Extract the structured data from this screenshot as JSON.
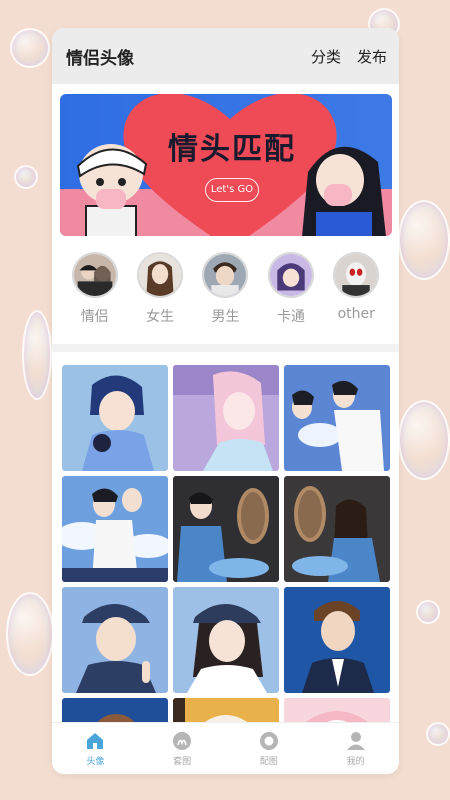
{
  "header": {
    "title": "情侣头像",
    "actions": [
      "分类",
      "发布"
    ]
  },
  "banner": {
    "title": "情头匹配",
    "subtitle": "Let's GO"
  },
  "categories": [
    {
      "label": "情侣",
      "icon": "couple-avatar"
    },
    {
      "label": "女生",
      "icon": "girl-avatar"
    },
    {
      "label": "男生",
      "icon": "boy-avatar"
    },
    {
      "label": "卡通",
      "icon": "cartoon-avatar"
    },
    {
      "label": "other",
      "icon": "other-avatar"
    }
  ],
  "grid": {
    "tiles": [
      {
        "name": "tile-boy-headphones",
        "colors": [
          "#9bc2e6",
          "#3b5bb5"
        ]
      },
      {
        "name": "tile-girl-pink-hair",
        "colors": [
          "#b9a7dd",
          "#f1b6cf"
        ]
      },
      {
        "name": "tile-couple-kiss-blue",
        "colors": [
          "#5b86d4",
          "#ffffff"
        ]
      },
      {
        "name": "tile-couple-sky",
        "colors": [
          "#6ea0e0",
          "#eaf2ff"
        ]
      },
      {
        "name": "tile-boy-mirror",
        "colors": [
          "#2f2f33",
          "#6aa0d8"
        ]
      },
      {
        "name": "tile-couple-mirror",
        "colors": [
          "#3a3838",
          "#8a6c52"
        ]
      },
      {
        "name": "tile-boy-cap",
        "colors": [
          "#8fb3e2",
          "#2c3e63"
        ]
      },
      {
        "name": "tile-girl-cap",
        "colors": [
          "#9ec0e6",
          "#2d3c5c"
        ]
      },
      {
        "name": "tile-boy-suit",
        "colors": [
          "#1f57a6",
          "#3a77c9"
        ]
      },
      {
        "name": "tile-partial-1",
        "colors": [
          "#1f4f9a",
          "#f2c9a8"
        ]
      },
      {
        "name": "tile-partial-2",
        "colors": [
          "#e8b14a",
          "#ffffff"
        ]
      },
      {
        "name": "tile-partial-3",
        "colors": [
          "#f5b7c3",
          "#ffffff"
        ]
      }
    ]
  },
  "tabbar": {
    "items": [
      {
        "label": "头像",
        "icon": "house-icon",
        "active": true
      },
      {
        "label": "套图",
        "icon": "album-icon",
        "active": false
      },
      {
        "label": "配图",
        "icon": "ring-icon",
        "active": false
      },
      {
        "label": "我的",
        "icon": "person-icon",
        "active": false
      }
    ]
  },
  "colors": {
    "accent": "#4aa5d8",
    "background": "#f3ddd0"
  }
}
